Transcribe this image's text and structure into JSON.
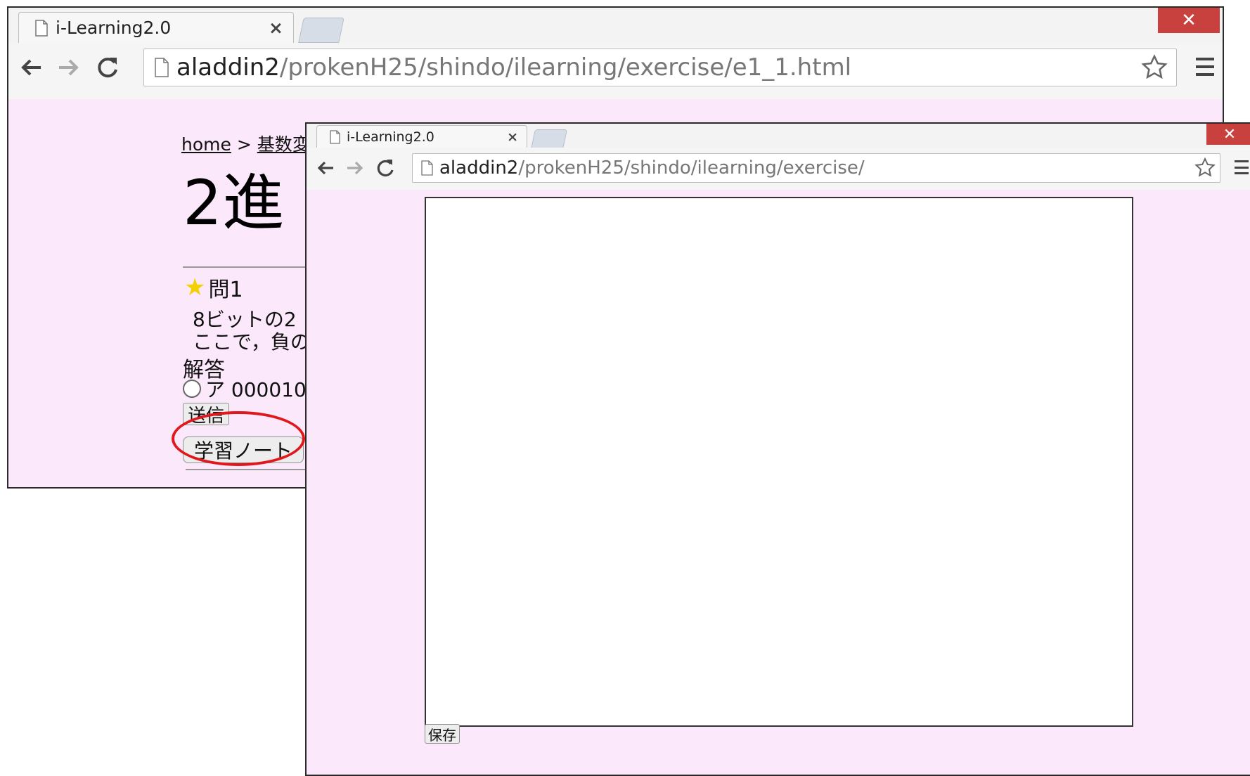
{
  "window_back": {
    "tab_title": "i-Learning2.0",
    "tab_close": "×",
    "close_glyph": "✕",
    "url_host": "aladdin2",
    "url_path": "/prokenH25/shindo/ilearning/exercise/e1_1.html",
    "page": {
      "breadcrumb_home": "home",
      "breadcrumb_sep": ">",
      "breadcrumb_current": "基数変",
      "title": "2進",
      "question_label": "問1",
      "question_text_line1": "8ビットの2",
      "question_text_line2": "ここで，負の",
      "answer_label": "解答",
      "option_a": "ア 000010",
      "send_button": "送信",
      "note_button": "学習ノート"
    }
  },
  "window_front": {
    "tab_title": "i-Learning2.0",
    "tab_close": "×",
    "close_glyph": "✕",
    "url_host": "aladdin2",
    "url_path": "/prokenH25/shindo/ilearning/exercise/",
    "page": {
      "save_button": "保存"
    }
  },
  "colors": {
    "page_background": "#fbe9fb",
    "close_button": "#c8413e",
    "highlight_oval": "#e0171b",
    "star": "#f5d000"
  }
}
